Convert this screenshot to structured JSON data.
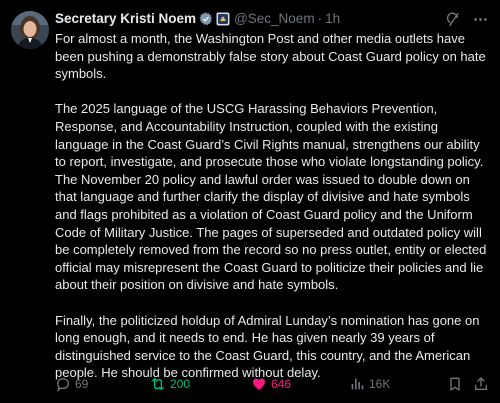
{
  "author": {
    "display_name": "Secretary Kristi Noem",
    "handle": "@Sec_Noem",
    "dot": "·",
    "timestamp": "1h",
    "verified_color": "#829aab"
  },
  "post": {
    "paragraphs": [
      "For almost a month, the Washington Post and other media outlets have been pushing a demonstrably false story about Coast Guard policy on hate symbols.",
      "The 2025 language of the USCG Harassing Behaviors Prevention, Response, and Accountability Instruction, coupled with the existing language in the Coast Guard’s Civil Rights manual, strengthens our ability to report, investigate, and prosecute those who violate longstanding policy. The November 20 policy and lawful order was issued to double down on that language and further clarify the display of divisive and hate symbols and flags prohibited as a violation of Coast Guard policy and the Uniform Code of Military Justice. The pages of superseded and outdated policy will be completely removed from the record so no press outlet, entity or elected official may misrepresent the Coast Guard to politicize their policies and lie about their position on divisive and hate symbols.",
      "Finally, the politicized holdup of Admiral Lunday’s nomination has gone on long enough, and it needs to end. He has given nearly 39 years of distinguished service to the Coast Guard, this country, and the American people. He should be confirmed without delay."
    ]
  },
  "actions": {
    "replies": "69",
    "reposts": "200",
    "likes": "646",
    "views": "16K",
    "repost_color": "#00ba7c",
    "like_color": "#f91880",
    "icon_names": [
      "reply-icon",
      "repost-icon",
      "like-icon",
      "views-icon",
      "bookmark-icon",
      "share-icon"
    ]
  },
  "header_icons": [
    "grok-icon",
    "more-icon"
  ]
}
